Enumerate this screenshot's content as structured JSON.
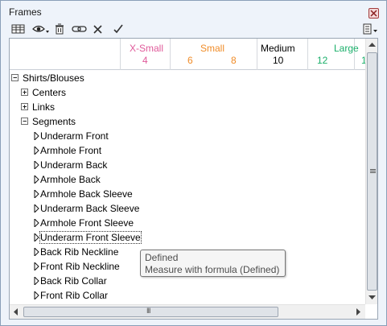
{
  "window": {
    "title": "Frames"
  },
  "columns": [
    {
      "label": "X-Small",
      "size": "4",
      "color": "#e05a9a"
    },
    {
      "label": "Small",
      "size": "6",
      "color": "#f08c28"
    },
    {
      "label": "",
      "size": "8",
      "color": "#f08c28"
    },
    {
      "label": "Medium",
      "size": "10",
      "color": "#000000"
    },
    {
      "label": "Large",
      "size": "12",
      "color": "#1aaf6a"
    },
    {
      "label": "",
      "size": "1",
      "color": "#1aaf6a"
    }
  ],
  "tree": {
    "root": "Shirts/Blouses",
    "groups": [
      "Centers",
      "Links",
      "Segments"
    ],
    "segments": [
      "Underarm Front",
      "Armhole Front",
      "Underarm Back",
      "Armhole Back",
      "Armhole Back Sleeve",
      "Underarm Back Sleeve",
      "Armhole Front Sleeve",
      "Underarm Front Sleeve",
      "Back Rib Neckline",
      "Front Rib Neckline",
      "Back Rib Collar",
      "Front Rib Collar"
    ]
  },
  "tooltip": {
    "line1": "Defined",
    "line2": "Measure with formula (Defined)"
  },
  "scrollbar": {
    "h_grip": "III"
  }
}
